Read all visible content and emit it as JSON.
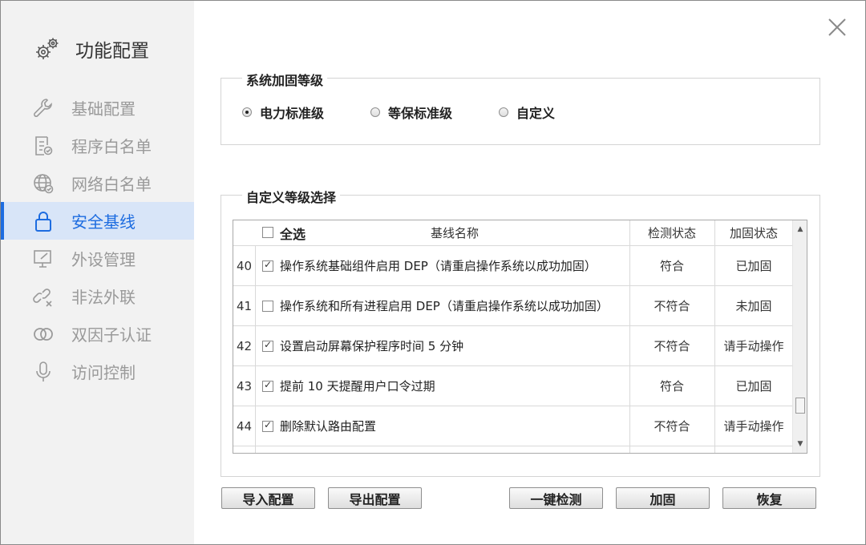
{
  "sidebar": {
    "title": "功能配置",
    "items": [
      {
        "label": "基础配置"
      },
      {
        "label": "程序白名单"
      },
      {
        "label": "网络白名单"
      },
      {
        "label": "安全基线"
      },
      {
        "label": "外设管理"
      },
      {
        "label": "非法外联"
      },
      {
        "label": "双因子认证"
      },
      {
        "label": "访问控制"
      }
    ],
    "active_index": 3
  },
  "level_group": {
    "legend": "系统加固等级",
    "options": [
      "电力标准级",
      "等保标准级",
      "自定义"
    ],
    "selected": "电力标准级"
  },
  "custom_group": {
    "legend": "自定义等级选择",
    "select_all_label": "全选",
    "columns": {
      "name": "基线名称",
      "detect": "检测状态",
      "harden": "加固状态"
    },
    "rows": [
      {
        "num": "40",
        "checked": true,
        "name": "操作系统基础组件启用 DEP（请重启操作系统以成功加固）",
        "detect": "符合",
        "harden": "已加固"
      },
      {
        "num": "41",
        "checked": false,
        "name": "操作系统和所有进程启用 DEP（请重启操作系统以成功加固）",
        "detect": "不符合",
        "harden": "未加固"
      },
      {
        "num": "42",
        "checked": true,
        "name": "设置启动屏幕保护程序时间 5 分钟",
        "detect": "不符合",
        "harden": "请手动操作"
      },
      {
        "num": "43",
        "checked": true,
        "name": "提前 10 天提醒用户口令过期",
        "detect": "符合",
        "harden": "已加固"
      },
      {
        "num": "44",
        "checked": true,
        "name": "删除默认路由配置",
        "detect": "不符合",
        "harden": "请手动操作"
      }
    ]
  },
  "buttons": {
    "import": "导入配置",
    "export": "导出配置",
    "check": "一键检测",
    "harden": "加固",
    "restore": "恢复"
  }
}
